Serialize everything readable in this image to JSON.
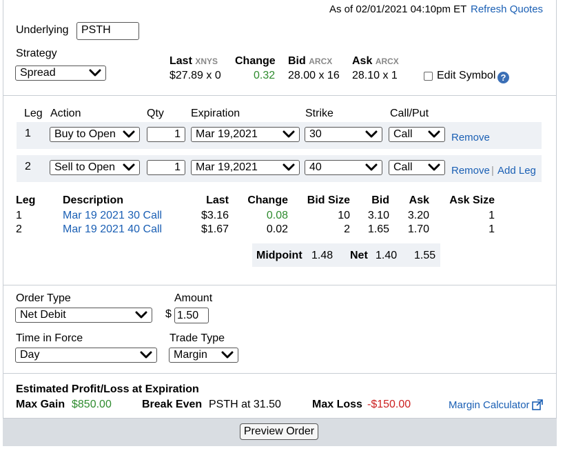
{
  "header": {
    "as_of": "As of 02/01/2021 04:10pm ET",
    "refresh_label": "Refresh Quotes"
  },
  "underlying": {
    "label": "Underlying",
    "value": "PSTH"
  },
  "strategy": {
    "label": "Strategy",
    "value": "Spread"
  },
  "quote": {
    "last_label": "Last",
    "last_exchange": "XNYS",
    "last_value": "$27.89 x 0",
    "change_label": "Change",
    "change_value": "0.32",
    "bid_label": "Bid",
    "bid_exchange": "ARCX",
    "bid_value": "28.00 x 16",
    "ask_label": "Ask",
    "ask_exchange": "ARCX",
    "ask_value": "28.10 x 1",
    "edit_symbol_label": "Edit Symbol",
    "edit_symbol_checked": false
  },
  "legs_header": {
    "leg": "Leg",
    "action": "Action",
    "qty": "Qty",
    "expiration": "Expiration",
    "strike": "Strike",
    "call_put": "Call/Put"
  },
  "legs": [
    {
      "num": "1",
      "action": "Buy to Open",
      "qty": "1",
      "expiration": "Mar 19,2021",
      "strike": "30",
      "call_put": "Call",
      "remove": "Remove",
      "add": ""
    },
    {
      "num": "2",
      "action": "Sell to Open",
      "qty": "1",
      "expiration": "Mar 19,2021",
      "strike": "40",
      "call_put": "Call",
      "remove": "Remove",
      "add": "Add Leg"
    }
  ],
  "leg_quotes_header": {
    "leg": "Leg",
    "description": "Description",
    "last": "Last",
    "change": "Change",
    "bid_size": "Bid Size",
    "bid": "Bid",
    "ask": "Ask",
    "ask_size": "Ask Size"
  },
  "leg_quotes": [
    {
      "leg": "1",
      "description": "Mar 19 2021 30 Call",
      "last": "$3.16",
      "change": "0.08",
      "bid_size": "10",
      "bid": "3.10",
      "ask": "3.20",
      "ask_size": "1"
    },
    {
      "leg": "2",
      "description": "Mar 19 2021 40 Call",
      "last": "$1.67",
      "change": "0.02",
      "bid_size": "2",
      "bid": "1.65",
      "ask": "1.70",
      "ask_size": "1"
    }
  ],
  "summary": {
    "midpoint_label": "Midpoint",
    "midpoint_value": "1.48",
    "net_label": "Net",
    "net_bid": "1.40",
    "net_ask": "1.55"
  },
  "order": {
    "order_type_label": "Order Type",
    "order_type_value": "Net Debit",
    "amount_label": "Amount",
    "currency": "$",
    "amount_value": "1.50",
    "tif_label": "Time in Force",
    "tif_value": "Day",
    "trade_type_label": "Trade Type",
    "trade_type_value": "Margin"
  },
  "estimate": {
    "title": "Estimated Profit/Loss at Expiration",
    "max_gain_label": "Max Gain",
    "max_gain_value": "$850.00",
    "break_even_label": "Break Even",
    "break_even_value": "PSTH at 31.50",
    "max_loss_label": "Max Loss",
    "max_loss_value": "-$150.00",
    "margin_calc_label": "Margin Calculator"
  },
  "footer": {
    "preview_label": "Preview Order"
  },
  "colors": {
    "link": "#1a5fb4",
    "positive": "#2e8b2e",
    "negative": "#cc1f1f",
    "band": "#eef1f5",
    "footer": "#d9dde2"
  }
}
